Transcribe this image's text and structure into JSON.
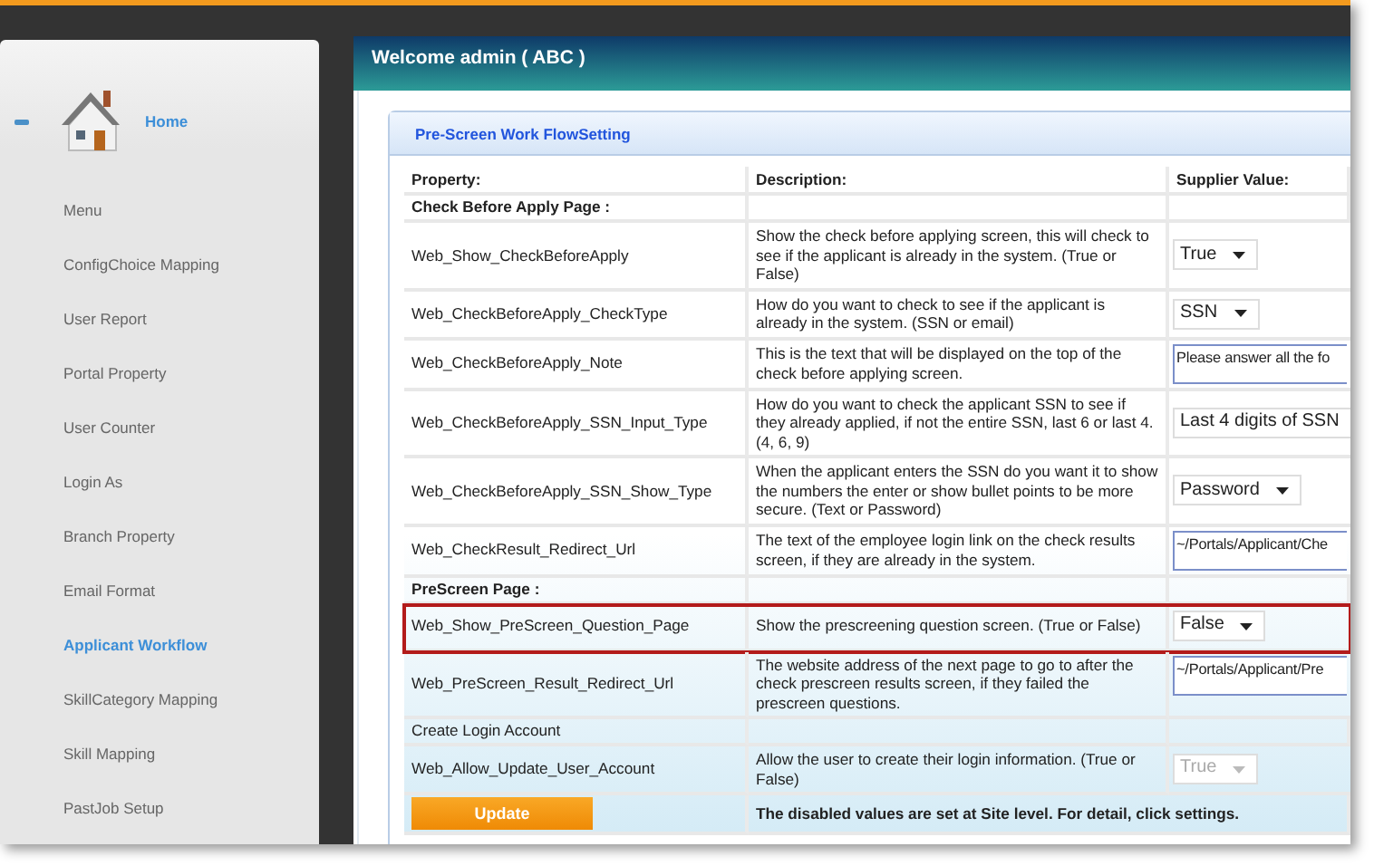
{
  "sidebar": {
    "home": {
      "label": "Home"
    },
    "items": [
      {
        "label": "Menu",
        "selected": false
      },
      {
        "label": "ConfigChoice Mapping",
        "selected": false
      },
      {
        "label": "User Report",
        "selected": false
      },
      {
        "label": "Portal Property",
        "selected": false
      },
      {
        "label": "User Counter",
        "selected": false
      },
      {
        "label": "Login As",
        "selected": false
      },
      {
        "label": "Branch Property",
        "selected": false
      },
      {
        "label": "Email Format",
        "selected": false
      },
      {
        "label": "Applicant Workflow",
        "selected": true
      },
      {
        "label": "SkillCategory Mapping",
        "selected": false
      },
      {
        "label": "Skill Mapping",
        "selected": false
      },
      {
        "label": "PastJob Setup",
        "selected": false
      }
    ]
  },
  "header": {
    "title": "Welcome admin ( ABC )"
  },
  "panel": {
    "title": "Pre-Screen Work FlowSetting",
    "columns": [
      "Property:",
      "Description:",
      "Supplier Value:"
    ],
    "rows": [
      {
        "kind": "section",
        "label": "Check Before Apply Page  :",
        "bold": true
      },
      {
        "kind": "setting",
        "property": "Web_Show_CheckBeforeApply",
        "description": "Show the check before applying screen, this will check to see if the applicant is already in the system. (True or False)",
        "value": {
          "kind": "select",
          "text": "True",
          "disabled": false
        },
        "highlighted": false
      },
      {
        "kind": "setting",
        "property": "Web_CheckBeforeApply_CheckType",
        "description": "How do you want to check to see if the applicant is already in the system. (SSN or email)",
        "value": {
          "kind": "select",
          "text": "SSN",
          "disabled": false
        },
        "highlighted": false
      },
      {
        "kind": "setting",
        "property": "Web_CheckBeforeApply_Note",
        "description": "This is the text that will be displayed on the top of the check before applying screen.",
        "value": {
          "kind": "text",
          "text": "Please answer all the fo"
        },
        "highlighted": false
      },
      {
        "kind": "setting",
        "property": "Web_CheckBeforeApply_SSN_Input_Type",
        "description": "How do you want to check the applicant SSN to see if they already applied, if not the entire SSN, last 6 or last 4. (4, 6, 9)",
        "value": {
          "kind": "select-cut",
          "text": "Last 4 digits of SSN",
          "disabled": false
        },
        "highlighted": false
      },
      {
        "kind": "setting",
        "property": "Web_CheckBeforeApply_SSN_Show_Type",
        "description": "When the applicant enters the SSN do you want it to show the numbers the enter or show bullet points to be more secure. (Text or Password)",
        "value": {
          "kind": "select",
          "text": "Password",
          "disabled": false
        },
        "highlighted": false
      },
      {
        "kind": "setting",
        "property": "Web_CheckResult_Redirect_Url",
        "description": "The text of the employee login link on the check results screen, if they are already in the system.",
        "value": {
          "kind": "text",
          "text": "~/Portals/Applicant/Che"
        },
        "highlighted": false
      },
      {
        "kind": "section",
        "label": "PreScreen Page :",
        "bold": true
      },
      {
        "kind": "setting",
        "property": "Web_Show_PreScreen_Question_Page",
        "description": "Show the prescreening question screen. (True or False)",
        "value": {
          "kind": "select",
          "text": "False",
          "disabled": false
        },
        "highlighted": true
      },
      {
        "kind": "setting",
        "property": "Web_PreScreen_Result_Redirect_Url",
        "description": "The website address of the next page to go to after the check prescreen results screen, if they failed the prescreen questions.",
        "value": {
          "kind": "text",
          "text": "~/Portals/Applicant/Pre"
        },
        "highlighted": false
      },
      {
        "kind": "section",
        "label": "Create Login Account",
        "bold": false
      },
      {
        "kind": "setting",
        "property": "Web_Allow_Update_User_Account",
        "description": "Allow the user to create their login information. (True or False)",
        "value": {
          "kind": "select",
          "text": "True",
          "disabled": true
        },
        "highlighted": false
      }
    ],
    "update_button": "Update",
    "footer_note": "The disabled values are set at Site level. For detail, click settings."
  }
}
